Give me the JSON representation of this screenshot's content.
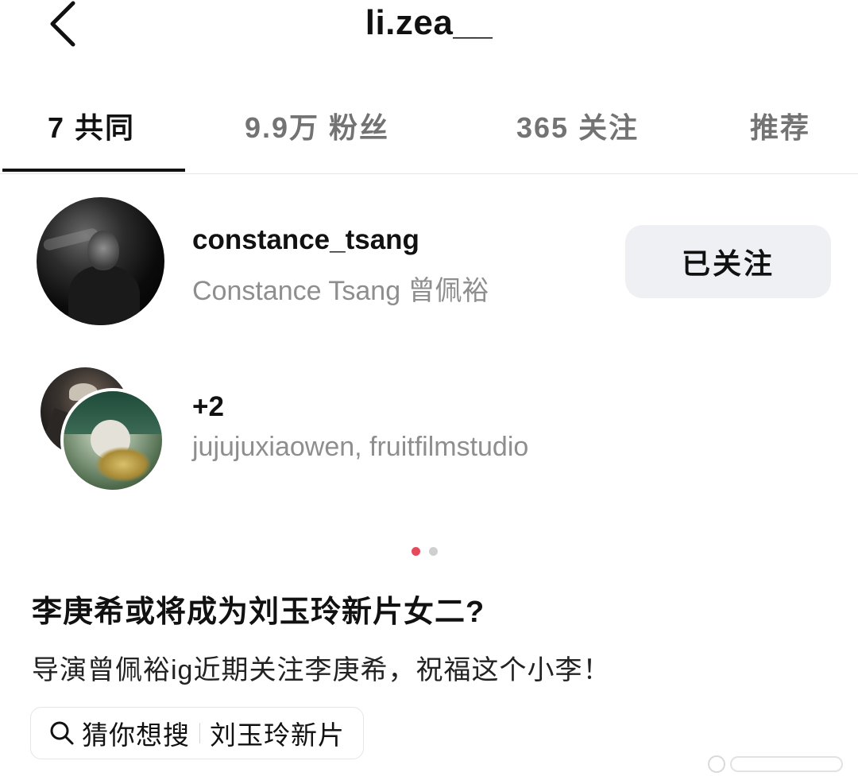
{
  "header": {
    "title": "li.zea__",
    "back_icon": "chevron-left-icon"
  },
  "tabs": [
    {
      "label": "7 共同",
      "active": true
    },
    {
      "label": "9.9万 粉丝",
      "active": false
    },
    {
      "label": "365 关注",
      "active": false
    },
    {
      "label": "推荐",
      "active": false
    }
  ],
  "mutual_list": [
    {
      "username": "constance_tsang",
      "fullname": "Constance Tsang 曾佩裕",
      "button_label": "已关注"
    },
    {
      "count_label": "+2",
      "names": "jujujuxiaowen, fruitfilmstudio"
    }
  ],
  "pager": {
    "count": 2,
    "active_index": 0,
    "active_color": "#e8485a"
  },
  "post": {
    "headline": "李庚希或将成为刘玉玲新片女二?",
    "body": "导演曾佩裕ig近期关注李庚希，祝福这个小李！"
  },
  "search_chip": {
    "icon": "search-icon",
    "prefix": "猜你想搜",
    "keyword": "刘玉玲新片"
  }
}
